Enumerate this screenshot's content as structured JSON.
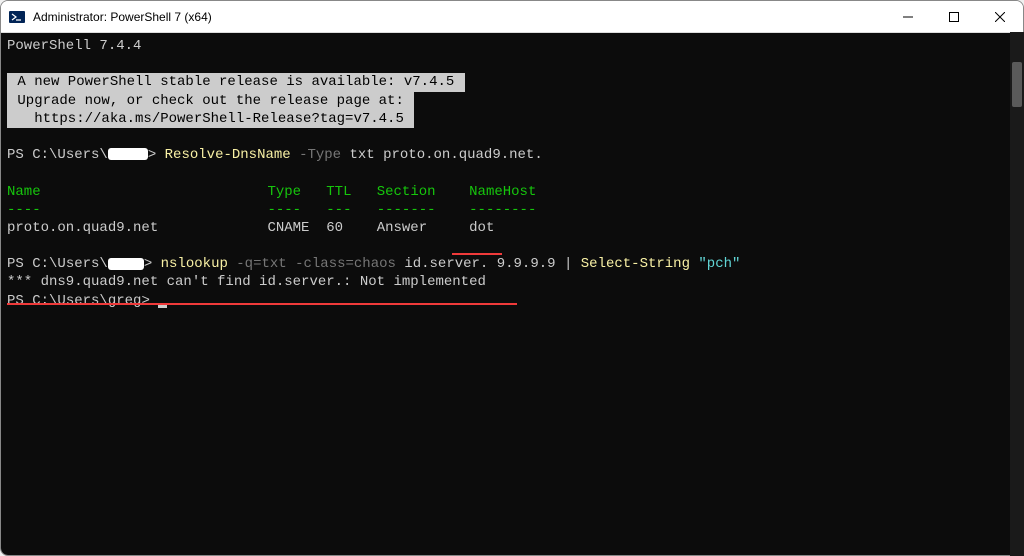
{
  "titlebar": {
    "title": "Administrator: PowerShell 7 (x64)"
  },
  "version": "PowerShell 7.4.4",
  "notice": {
    "line1": " A new PowerShell stable release is available: v7.4.5 ",
    "line2": " Upgrade now, or check out the release page at: ",
    "line3": "   https://aka.ms/PowerShell-Release?tag=v7.4.5 "
  },
  "prompt1": {
    "ps": "PS ",
    "path": "C:\\Users\\",
    "gt": "> ",
    "cmd": "Resolve-DnsName ",
    "flag": "-Type ",
    "args": "txt proto.on.quad9.net."
  },
  "table": {
    "h_name": "Name",
    "h_type": "Type",
    "h_ttl": "TTL",
    "h_section": "Section",
    "h_namehost": "NameHost",
    "d_name": "----",
    "d_type": "----",
    "d_ttl": "---",
    "d_section": "-------",
    "d_namehost": "--------",
    "r_name": "proto.on.quad9.net",
    "r_type": "CNAME",
    "r_ttl": "60",
    "r_section": "Answer",
    "r_namehost": "dot"
  },
  "prompt2": {
    "ps": "PS ",
    "path": "C:\\Users\\",
    "gt": "> ",
    "cmd": "nslookup ",
    "flags": "-q=txt -class=chaos ",
    "args": "id.server. 9.9.9.9 ",
    "pipe": "| ",
    "cmd2": "Select-String ",
    "str": "\"pch\""
  },
  "error": "*** dns9.quad9.net can't find id.server.: Not implemented",
  "prompt3": {
    "ps": "PS ",
    "path": "C:\\Users\\greg",
    "gt": "> "
  }
}
